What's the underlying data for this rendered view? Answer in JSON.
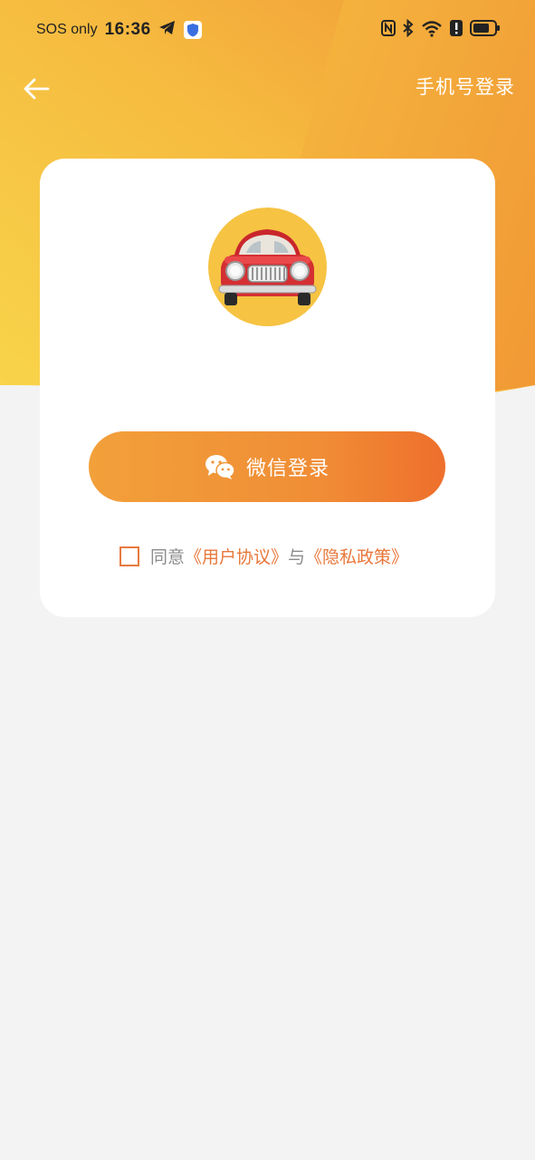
{
  "status_bar": {
    "carrier": "SOS only",
    "time": "16:36"
  },
  "header": {
    "phone_login_label": "手机号登录"
  },
  "login": {
    "wechat_label": "微信登录",
    "agreement": {
      "prefix": "同意",
      "user_agreement": "《用户协议》",
      "conjunction": "与",
      "privacy_policy": "《隐私政策》",
      "checked": false
    }
  },
  "colors": {
    "header_gradient_start": "#f8d54a",
    "header_gradient_end": "#f19a36",
    "button_start": "#f2a03a",
    "button_end": "#ee6f2c",
    "link": "#e8773a",
    "logo_bg": "#f6c343"
  }
}
